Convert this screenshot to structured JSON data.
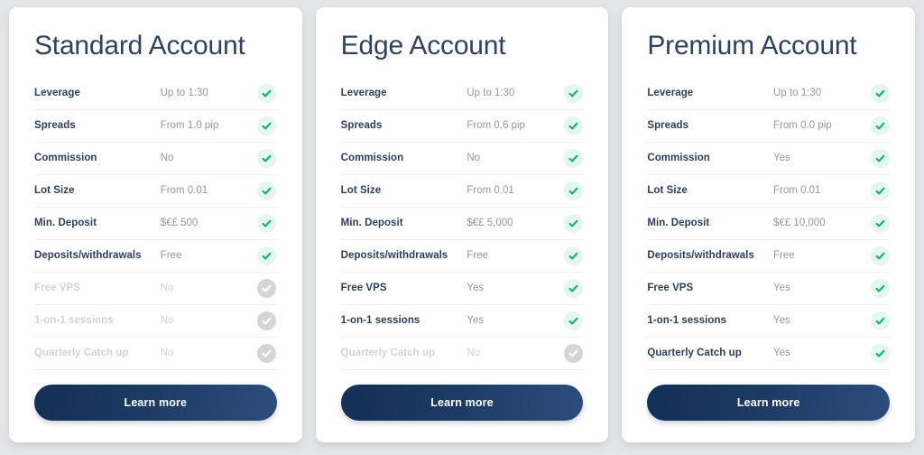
{
  "theme": {
    "page_background": "#e4e5e7",
    "card_background": "#ffffff",
    "title_color": "#31425f",
    "label_color": "#2d3e5c",
    "value_color": "#8f98a8",
    "disabled_color": "#cfd3d9",
    "check_green": "#1bb271",
    "check_green_background": "#e4f7ee",
    "check_disabled_background": "#d2d5da",
    "button_gradient_start": "#152f56",
    "button_gradient_end": "#2c4d7d",
    "divider_color": "#eef0f3"
  },
  "cards": [
    {
      "title": "Standard Account",
      "cta_label": "Learn more",
      "rows": [
        {
          "label": "Leverage",
          "value": "Up to 1:30",
          "icon": "check-circle-icon",
          "enabled": true
        },
        {
          "label": "Spreads",
          "value": "From 1.0 pip",
          "icon": "check-circle-icon",
          "enabled": true
        },
        {
          "label": "Commission",
          "value": "No",
          "icon": "check-circle-icon",
          "enabled": true
        },
        {
          "label": "Lot Size",
          "value": "From 0.01",
          "icon": "check-circle-icon",
          "enabled": true
        },
        {
          "label": "Min. Deposit",
          "value": "$€£ 500",
          "icon": "check-circle-icon",
          "enabled": true
        },
        {
          "label": "Deposits/withdrawals",
          "value": "Free",
          "icon": "check-circle-icon",
          "enabled": true
        },
        {
          "label": "Free VPS",
          "value": "No",
          "icon": "check-circle-icon",
          "enabled": false
        },
        {
          "label": "1-on-1 sessions",
          "value": "No",
          "icon": "check-circle-icon",
          "enabled": false
        },
        {
          "label": "Quarterly Catch up",
          "value": "No",
          "icon": "check-circle-icon",
          "enabled": false
        }
      ]
    },
    {
      "title": "Edge Account",
      "cta_label": "Learn more",
      "rows": [
        {
          "label": "Leverage",
          "value": "Up to 1:30",
          "icon": "check-circle-icon",
          "enabled": true
        },
        {
          "label": "Spreads",
          "value": "From 0.6 pip",
          "icon": "check-circle-icon",
          "enabled": true
        },
        {
          "label": "Commission",
          "value": "No",
          "icon": "check-circle-icon",
          "enabled": true
        },
        {
          "label": "Lot Size",
          "value": "From 0.01",
          "icon": "check-circle-icon",
          "enabled": true
        },
        {
          "label": "Min. Deposit",
          "value": "$€£ 5,000",
          "icon": "check-circle-icon",
          "enabled": true
        },
        {
          "label": "Deposits/withdrawals",
          "value": "Free",
          "icon": "check-circle-icon",
          "enabled": true
        },
        {
          "label": "Free VPS",
          "value": "Yes",
          "icon": "check-circle-icon",
          "enabled": true
        },
        {
          "label": "1-on-1 sessions",
          "value": "Yes",
          "icon": "check-circle-icon",
          "enabled": true
        },
        {
          "label": "Quarterly Catch up",
          "value": "No",
          "icon": "check-circle-icon",
          "enabled": false
        }
      ]
    },
    {
      "title": "Premium Account",
      "cta_label": "Learn more",
      "rows": [
        {
          "label": "Leverage",
          "value": "Up to 1:30",
          "icon": "check-circle-icon",
          "enabled": true
        },
        {
          "label": "Spreads",
          "value": "From 0.0 pip",
          "icon": "check-circle-icon",
          "enabled": true
        },
        {
          "label": "Commission",
          "value": "Yes",
          "icon": "check-circle-icon",
          "enabled": true
        },
        {
          "label": "Lot Size",
          "value": "From 0.01",
          "icon": "check-circle-icon",
          "enabled": true
        },
        {
          "label": "Min. Deposit",
          "value": "$€£ 10,000",
          "icon": "check-circle-icon",
          "enabled": true
        },
        {
          "label": "Deposits/withdrawals",
          "value": "Free",
          "icon": "check-circle-icon",
          "enabled": true
        },
        {
          "label": "Free VPS",
          "value": "Yes",
          "icon": "check-circle-icon",
          "enabled": true
        },
        {
          "label": "1-on-1 sessions",
          "value": "Yes",
          "icon": "check-circle-icon",
          "enabled": true
        },
        {
          "label": "Quarterly Catch up",
          "value": "Yes",
          "icon": "check-circle-icon",
          "enabled": true
        }
      ]
    }
  ]
}
